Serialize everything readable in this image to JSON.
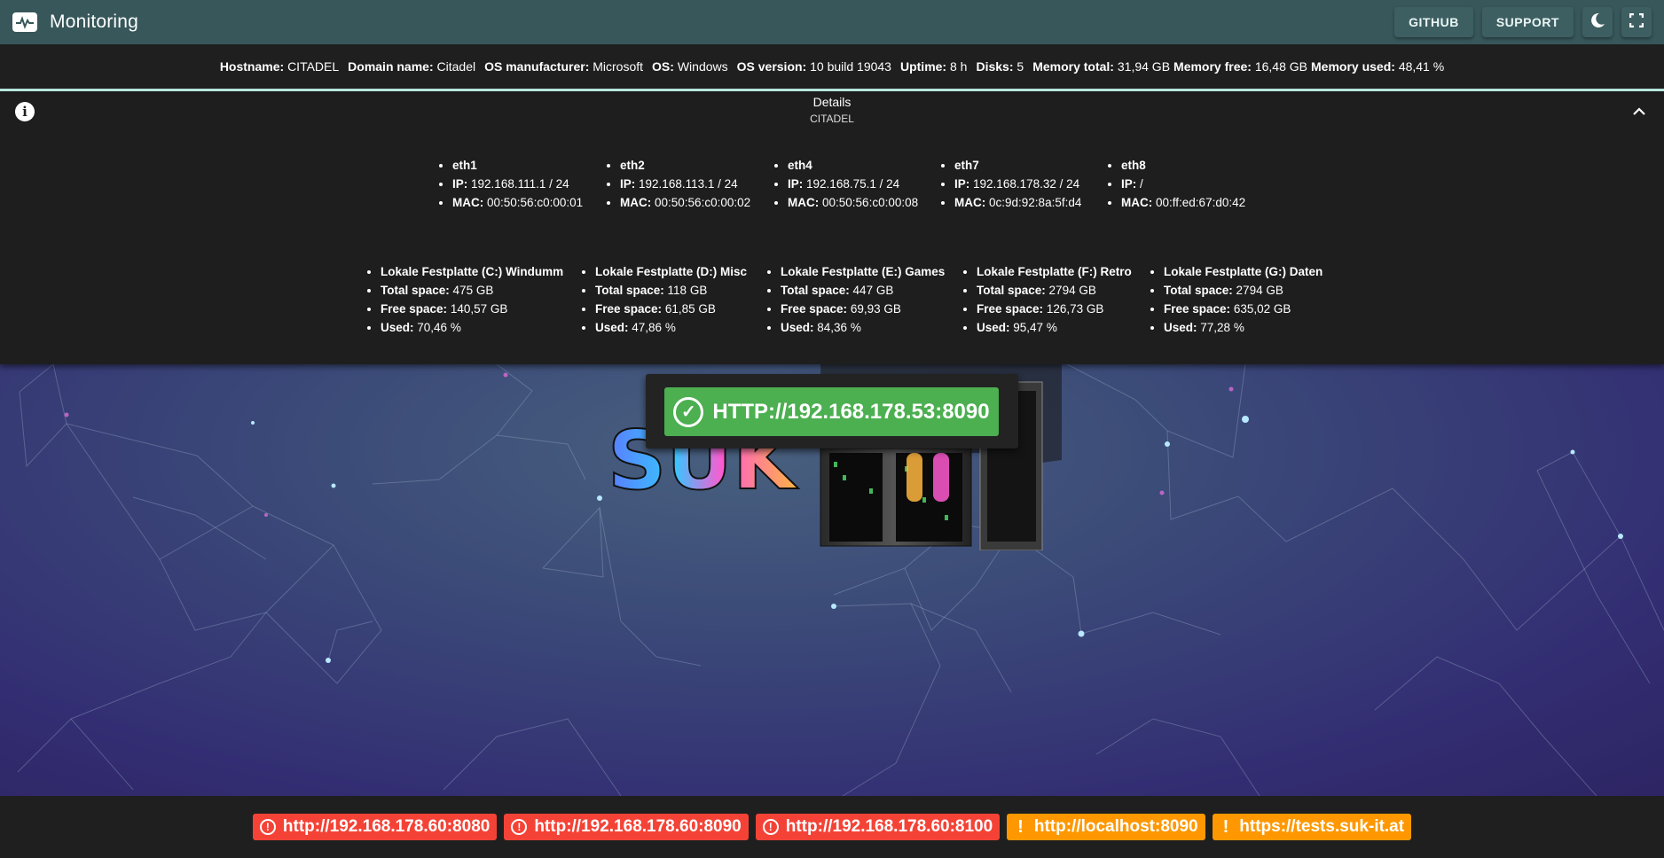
{
  "app": {
    "title": "Monitoring"
  },
  "toolbar": {
    "github_label": "GITHUB",
    "support_label": "SUPPORT"
  },
  "sysinfo": [
    {
      "label": "Hostname:",
      "value": "CITADEL"
    },
    {
      "label": "Domain name:",
      "value": "Citadel"
    },
    {
      "label": "OS manufacturer:",
      "value": "Microsoft"
    },
    {
      "label": "OS:",
      "value": "Windows"
    },
    {
      "label": "OS version:",
      "value": "10 build 19043"
    },
    {
      "label": "Uptime:",
      "value": "8 h"
    },
    {
      "label": "Disks:",
      "value": "5"
    },
    {
      "label": "Memory total:",
      "value": "31,94 GB"
    },
    {
      "label": "Memory free:",
      "value": "16,48 GB"
    },
    {
      "label": "Memory used:",
      "value": "48,41 %"
    }
  ],
  "details": {
    "title": "Details",
    "subtitle": "CITADEL",
    "ip_label": "IP:",
    "mac_label": "MAC:",
    "total_label": "Total space:",
    "free_label": "Free space:",
    "used_label": "Used:",
    "interfaces": [
      {
        "name": "eth1",
        "ip": "192.168.111.1 / 24",
        "mac": "00:50:56:c0:00:01"
      },
      {
        "name": "eth2",
        "ip": "192.168.113.1 / 24",
        "mac": "00:50:56:c0:00:02"
      },
      {
        "name": "eth4",
        "ip": "192.168.75.1 / 24",
        "mac": "00:50:56:c0:00:08"
      },
      {
        "name": "eth7",
        "ip": "192.168.178.32 / 24",
        "mac": "0c:9d:92:8a:5f:d4"
      },
      {
        "name": "eth8",
        "ip": "/",
        "mac": "00:ff:ed:67:d0:42"
      }
    ],
    "disks": [
      {
        "name": "Lokale Festplatte (C:) Windumm",
        "total": "475 GB",
        "free": "140,57 GB",
        "used": "70,46 %"
      },
      {
        "name": "Lokale Festplatte (D:) Misc",
        "total": "118 GB",
        "free": "61,85 GB",
        "used": "47,86 %"
      },
      {
        "name": "Lokale Festplatte (E:) Games",
        "total": "447 GB",
        "free": "69,93 GB",
        "used": "84,36 %"
      },
      {
        "name": "Lokale Festplatte (F:) Retro",
        "total": "2794 GB",
        "free": "126,73 GB",
        "used": "95,47 %"
      },
      {
        "name": "Lokale Festplatte (G:) Daten",
        "total": "2794 GB",
        "free": "635,02 GB",
        "used": "77,28 %"
      }
    ]
  },
  "main_status": {
    "url": "HTTP://192.168.178.53:8090",
    "status": "ok",
    "color": "#4caf50"
  },
  "logo": {
    "text": "SUK-IT"
  },
  "footer_links": [
    {
      "url": "http://192.168.178.60:8080",
      "status": "error",
      "color": "#f44336"
    },
    {
      "url": "http://192.168.178.60:8090",
      "status": "error",
      "color": "#f44336"
    },
    {
      "url": "http://192.168.178.60:8100",
      "status": "error",
      "color": "#f44336"
    },
    {
      "url": "http://localhost:8090",
      "status": "warning",
      "color": "#ff9800"
    },
    {
      "url": "https://tests.suk-it.at",
      "status": "warning",
      "color": "#ff9800"
    }
  ],
  "colors": {
    "appbar": "#37575a",
    "panel": "#1e1e1e",
    "accent": "#b8e6df"
  },
  "icons": [
    "pulse-icon",
    "moon-icon",
    "fullscreen-icon",
    "info-icon",
    "chevron-up-icon",
    "check-circle-icon",
    "alert-circle-icon",
    "exclamation-icon"
  ]
}
